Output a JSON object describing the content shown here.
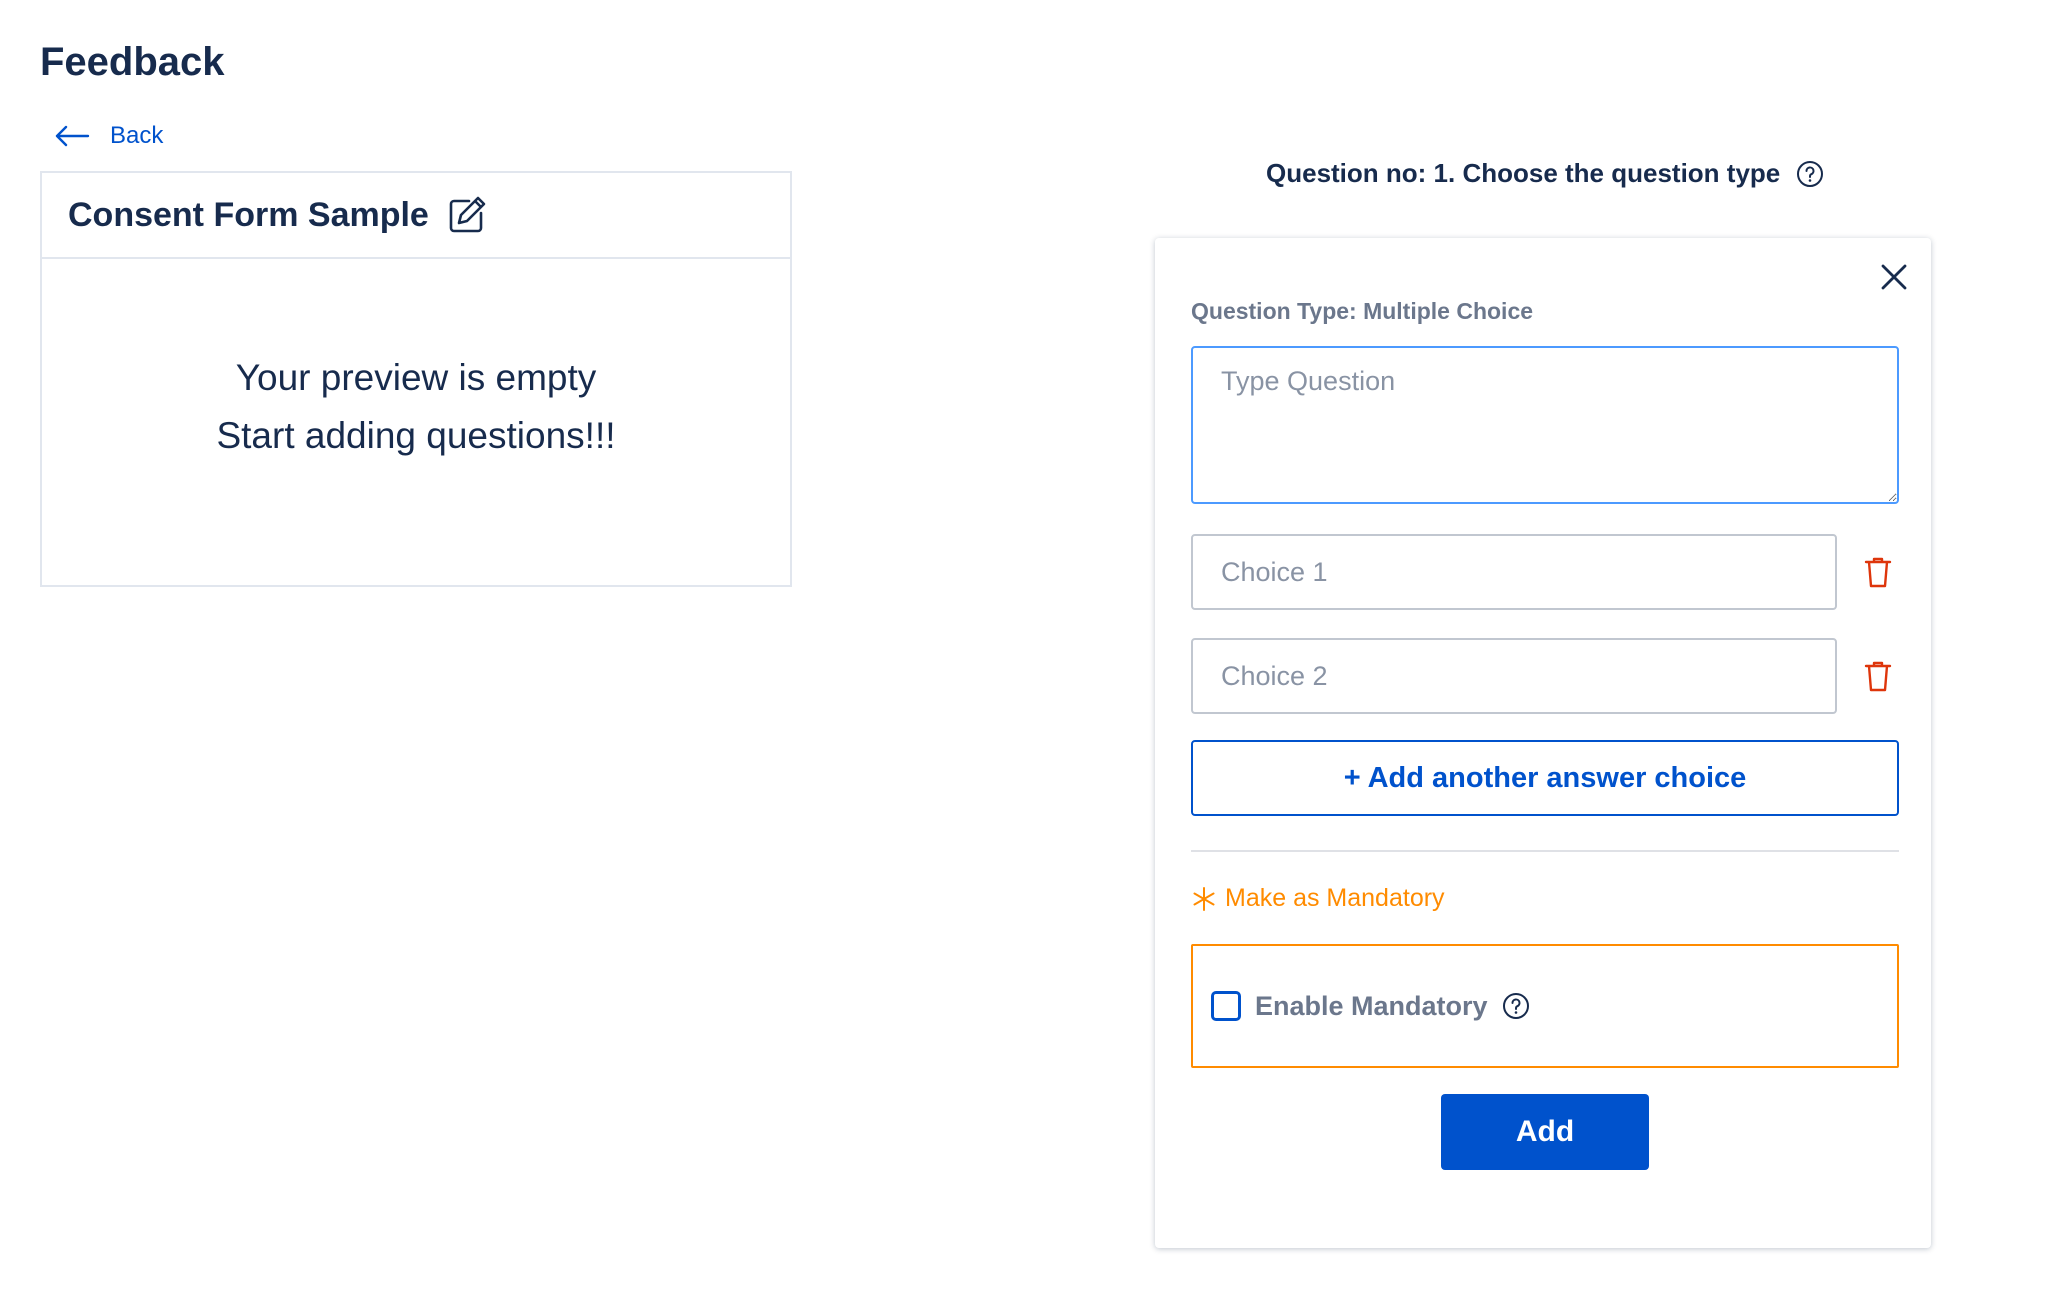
{
  "page": {
    "title": "Feedback"
  },
  "back": {
    "label": "Back",
    "icon": "arrow-left-icon"
  },
  "preview": {
    "form_title": "Consent Form Sample",
    "empty_line1": "Your preview is empty",
    "empty_line2": "Start adding questions!!!"
  },
  "question": {
    "heading": "Question no: 1. Choose the question type",
    "type_label": "Question Type: Multiple Choice",
    "question_placeholder": "Type Question",
    "choices": [
      {
        "placeholder": "Choice 1",
        "value": ""
      },
      {
        "placeholder": "Choice 2",
        "value": ""
      }
    ],
    "add_choice_label": "+ Add another answer choice",
    "mandatory_label": "Make as Mandatory",
    "enable_mandatory_label": "Enable Mandatory",
    "enable_mandatory_checked": false,
    "add_label": "Add"
  },
  "colors": {
    "primary": "#0052cc",
    "warning": "#ff8b00",
    "danger": "#de350b",
    "text": "#172b4d",
    "muted": "#6b778c"
  }
}
